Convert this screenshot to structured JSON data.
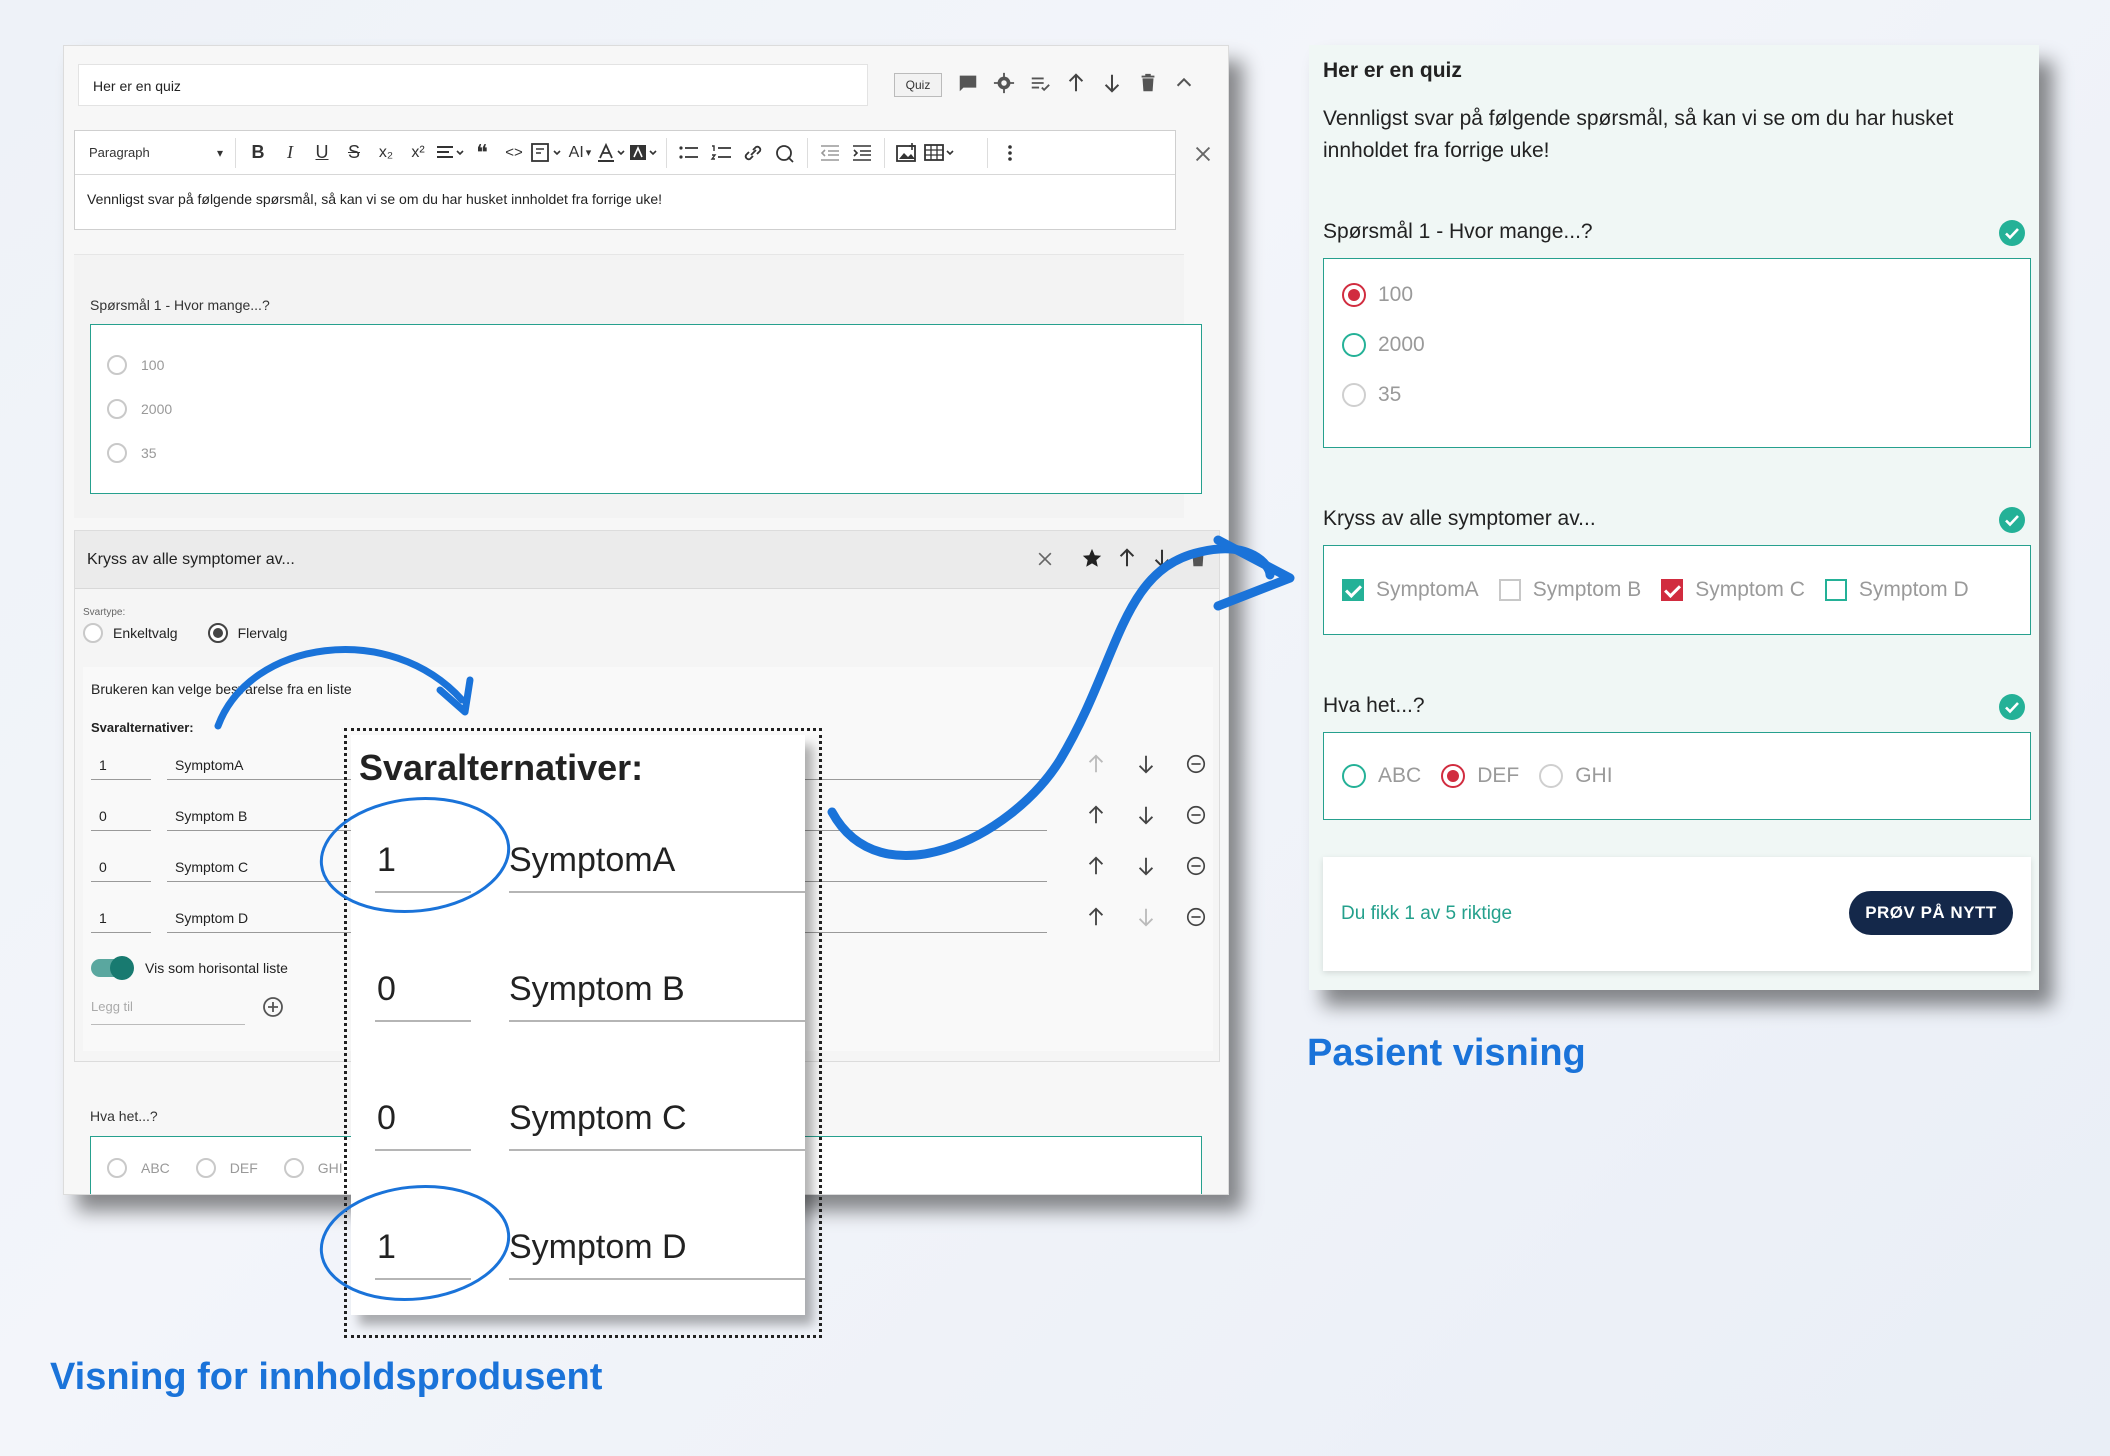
{
  "editor": {
    "title_value": "Her er en quiz",
    "type_badge": "Quiz",
    "toolbar": {
      "paragraph_select": "Paragraph",
      "buttons": [
        "B",
        "I",
        "U",
        "S",
        "x₂",
        "x²",
        "❝",
        "<>",
        "AI"
      ]
    },
    "intro_text": "Vennligst svar på følgende spørsmål, så kan vi se om du har husket innholdet fra forrige uke!",
    "q1": {
      "label": "Spørsmål 1 - Hvor mange...?",
      "options": [
        "100",
        "2000",
        "35"
      ]
    },
    "q2": {
      "header": "Kryss av alle symptomer av...",
      "svartype_label": "Svartype:",
      "svartype_single": "Enkeltvalg",
      "svartype_multi": "Flervalg",
      "hint": "Brukeren kan velge besvarelse fra en liste",
      "alternatives_label": "Svaralternativer:",
      "alternatives": [
        {
          "score": "1",
          "text": "SymptomA"
        },
        {
          "score": "0",
          "text": "Symptom B"
        },
        {
          "score": "0",
          "text": "Symptom C"
        },
        {
          "score": "1",
          "text": "Symptom D"
        }
      ],
      "horizontal_toggle_label": "Vis som horisontal liste",
      "add_placeholder": "Legg til"
    },
    "q3": {
      "label": "Hva het...?",
      "options": [
        "ABC",
        "DEF",
        "GHI"
      ]
    }
  },
  "zoom": {
    "title": "Svaralternativer:",
    "rows": [
      {
        "score": "1",
        "text": "SymptomA"
      },
      {
        "score": "0",
        "text": "Symptom B"
      },
      {
        "score": "0",
        "text": "Symptom C"
      },
      {
        "score": "1",
        "text": "Symptom D"
      }
    ]
  },
  "patient": {
    "title": "Her er en quiz",
    "intro": "Vennligst svar på følgende spørsmål, så kan vi se om du har husket innholdet fra forrige uke!",
    "q1": {
      "label": "Spørsmål 1 - Hvor mange...?",
      "options": [
        "100",
        "2000",
        "35"
      ],
      "selected": "100"
    },
    "q2": {
      "label": "Kryss av alle symptomer av...",
      "options": [
        "SymptomA",
        "Symptom B",
        "Symptom C",
        "Symptom D"
      ],
      "checked": [
        "SymptomA",
        "Symptom C"
      ]
    },
    "q3": {
      "label": "Hva het...?",
      "options": [
        "ABC",
        "DEF",
        "GHI"
      ],
      "selected": "DEF"
    },
    "result_text": "Du fikk 1 av 5 riktige",
    "retry_button": "PRØV PÅ NYTT"
  },
  "captions": {
    "patient": "Pasient visning",
    "producer": "Visning for innholdsprodusent"
  },
  "colors": {
    "accent_teal": "#26a08e",
    "wrong_red": "#d12c3f",
    "annotation_blue": "#1a73d9",
    "button_navy": "#14284a"
  }
}
